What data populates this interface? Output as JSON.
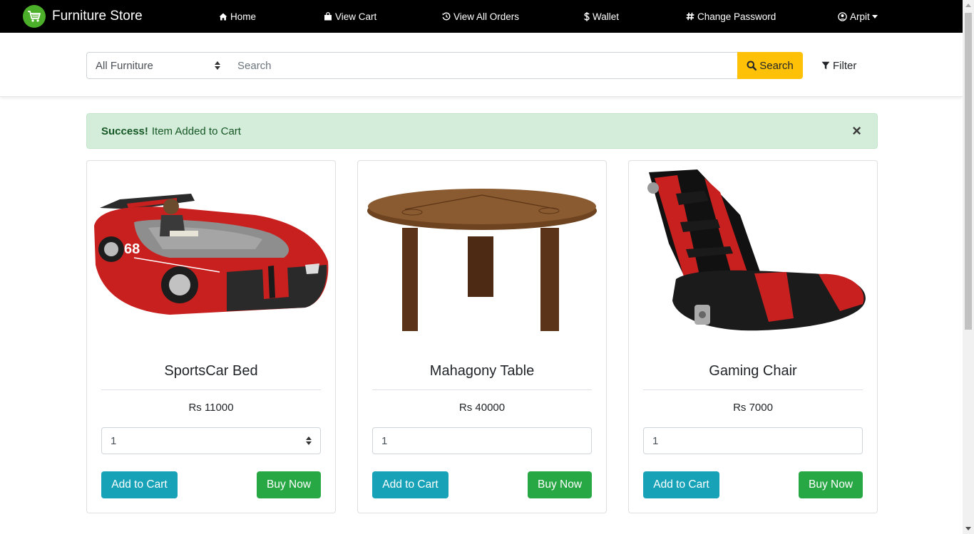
{
  "navbar": {
    "brand": "Furniture Store",
    "items": [
      {
        "label": "Home",
        "icon": "home-icon"
      },
      {
        "label": "View Cart",
        "icon": "shopping-bag-icon"
      },
      {
        "label": "View All Orders",
        "icon": "history-icon"
      },
      {
        "label": "Wallet",
        "icon": "dollar-icon"
      },
      {
        "label": "Change Password",
        "icon": "hash-icon"
      },
      {
        "label": "Arpit",
        "icon": "user-circle-icon"
      }
    ],
    "colors": {
      "background": "#000000",
      "logo": "#4caf2a"
    }
  },
  "search": {
    "category_selected": "All Furniture",
    "placeholder": "Search",
    "button_label": "Search",
    "filter_label": "Filter",
    "button_color": "#ffc107"
  },
  "alert": {
    "strong": "Success!",
    "message": "Item Added to Cart",
    "close": "×",
    "color": "#d4edda"
  },
  "products": [
    {
      "name": "SportsCar Bed",
      "price": "Rs 11000",
      "quantity": "1",
      "add_label": "Add to Cart",
      "buy_label": "Buy Now",
      "image": "red race car bed"
    },
    {
      "name": "Mahagony Table",
      "price": "Rs 40000",
      "quantity": "1",
      "add_label": "Add to Cart",
      "buy_label": "Buy Now",
      "image": "round wooden table"
    },
    {
      "name": "Gaming Chair",
      "price": "Rs 7000",
      "quantity": "1",
      "add_label": "Add to Cart",
      "buy_label": "Buy Now",
      "image": "black and red rocker gaming chair"
    }
  ],
  "button_colors": {
    "add_to_cart": "#17a2b8",
    "buy_now": "#28a745"
  }
}
